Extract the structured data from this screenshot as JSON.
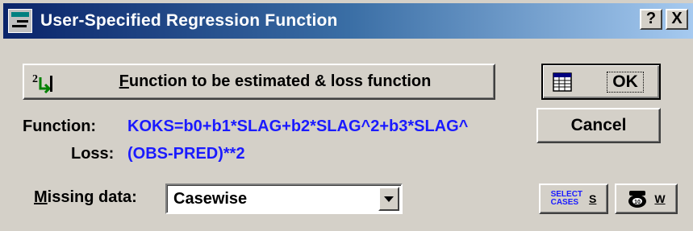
{
  "window": {
    "title": "User-Specified Regression Function",
    "help_label": "?",
    "close_label": "X"
  },
  "buttons": {
    "function_label_prefix": "F",
    "function_label_rest": "unction to be estimated & loss function",
    "ok_label": "OK",
    "cancel_label": "Cancel",
    "select_cases_line1": "SELECT",
    "select_cases_line2": "CASES",
    "select_cases_shortcut": "S",
    "weight_shortcut": "W"
  },
  "fields": {
    "function_label": "Function:",
    "function_value": "KOKS=b0+b1*SLAG+b2*SLAG^2+b3*SLAG^",
    "loss_label": "Loss:",
    "loss_value": "(OBS-PRED)**2",
    "missing_label_prefix": "M",
    "missing_label_rest": "issing data:",
    "missing_value": "Casewise"
  },
  "colors": {
    "accent_text": "#1a1aff",
    "title_bar_start": "#0a246a",
    "title_bar_end": "#a6caf0",
    "face": "#d4d0c8"
  },
  "icons": {
    "title": "app-icon",
    "function": "function-icon",
    "ok": "spreadsheet-icon",
    "weight": "weight-icon",
    "dropdown": "chevron-down-icon"
  }
}
